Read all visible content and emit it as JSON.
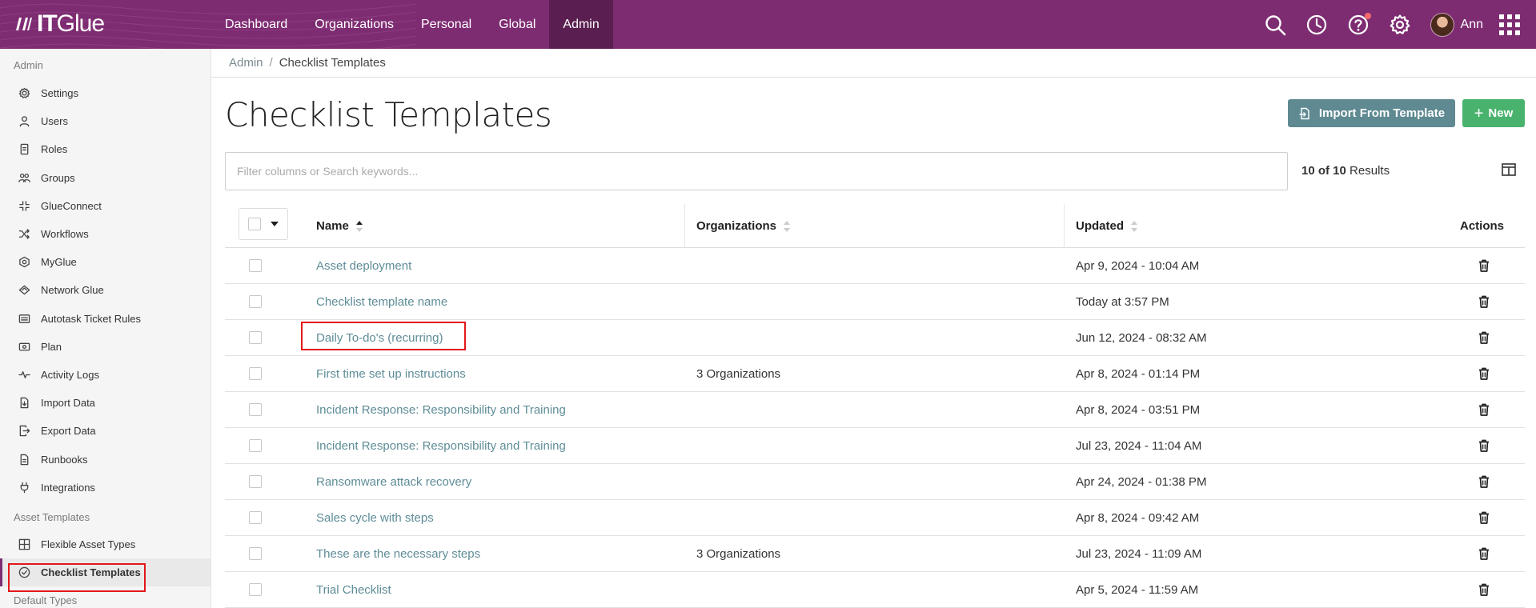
{
  "header": {
    "logo_it": "IT",
    "logo_glue": "Glue",
    "nav": [
      {
        "label": "Dashboard",
        "active": false
      },
      {
        "label": "Organizations",
        "active": false
      },
      {
        "label": "Personal",
        "active": false
      },
      {
        "label": "Global",
        "active": false
      },
      {
        "label": "Admin",
        "active": true
      }
    ],
    "user_name": "Ann",
    "icons": [
      "search-icon",
      "history-icon",
      "help-icon",
      "settings-icon",
      "apps-grid-icon"
    ],
    "colors": {
      "bar": "#7e2c72",
      "active_nav": "#5a1f50",
      "notification": "#f36b6b"
    }
  },
  "sidebar": {
    "section_admin": "Admin",
    "items": [
      {
        "label": "Settings",
        "icon": "gear-icon"
      },
      {
        "label": "Users",
        "icon": "user-icon"
      },
      {
        "label": "Roles",
        "icon": "badge-icon"
      },
      {
        "label": "Groups",
        "icon": "users-group-icon"
      },
      {
        "label": "GlueConnect",
        "icon": "glueconnect-icon"
      },
      {
        "label": "Workflows",
        "icon": "shuffle-icon"
      },
      {
        "label": "MyGlue",
        "icon": "myglue-icon"
      },
      {
        "label": "Network Glue",
        "icon": "network-glue-icon"
      },
      {
        "label": "Autotask Ticket Rules",
        "icon": "ticket-rules-icon"
      },
      {
        "label": "Plan",
        "icon": "plan-icon"
      },
      {
        "label": "Activity Logs",
        "icon": "pulse-icon"
      },
      {
        "label": "Import Data",
        "icon": "import-icon"
      },
      {
        "label": "Export Data",
        "icon": "export-icon"
      },
      {
        "label": "Runbooks",
        "icon": "document-icon"
      },
      {
        "label": "Integrations",
        "icon": "plug-icon"
      }
    ],
    "section_asset": "Asset Templates",
    "asset_items": [
      {
        "label": "Flexible Asset Types",
        "icon": "grid-icon"
      },
      {
        "label": "Checklist Templates",
        "icon": "check-circle-icon",
        "active": true
      }
    ],
    "section_default": "Default Types"
  },
  "breadcrumb": {
    "parent": "Admin",
    "separator": "/",
    "current": "Checklist Templates"
  },
  "page": {
    "title": "Checklist Templates",
    "import_button": "Import From Template",
    "new_button": "New",
    "search_placeholder": "Filter columns or Search keywords...",
    "results_count": "10 of 10",
    "results_label": "Results",
    "colors": {
      "import": "#5f8a92",
      "new": "#49b36e",
      "link": "#5e8d97"
    }
  },
  "table": {
    "columns": {
      "name": "Name",
      "organizations": "Organizations",
      "updated": "Updated",
      "actions": "Actions"
    },
    "rows": [
      {
        "name": "Asset deployment",
        "organizations": "",
        "updated": "Apr 9, 2024 - 10:04 AM"
      },
      {
        "name": "Checklist template name",
        "organizations": "",
        "updated": "Today at 3:57 PM"
      },
      {
        "name": "Daily To-do's (recurring)",
        "organizations": "",
        "updated": "Jun 12, 2024 - 08:32 AM"
      },
      {
        "name": "First time set up instructions",
        "organizations": "3 Organizations",
        "updated": "Apr 8, 2024 - 01:14 PM"
      },
      {
        "name": "Incident Response: Responsibility and Training",
        "organizations": "",
        "updated": "Apr 8, 2024 - 03:51 PM"
      },
      {
        "name": "Incident Response: Responsibility and Training",
        "organizations": "",
        "updated": "Jul 23, 2024 - 11:04 AM"
      },
      {
        "name": "Ransomware attack recovery",
        "organizations": "",
        "updated": "Apr 24, 2024 - 01:38 PM"
      },
      {
        "name": "Sales cycle with steps",
        "organizations": "",
        "updated": "Apr 8, 2024 - 09:42 AM"
      },
      {
        "name": "These are the necessary steps",
        "organizations": "3 Organizations",
        "updated": "Jul 23, 2024 - 11:09 AM"
      },
      {
        "name": "Trial Checklist",
        "organizations": "",
        "updated": "Apr 5, 2024 - 11:59 AM"
      }
    ]
  }
}
